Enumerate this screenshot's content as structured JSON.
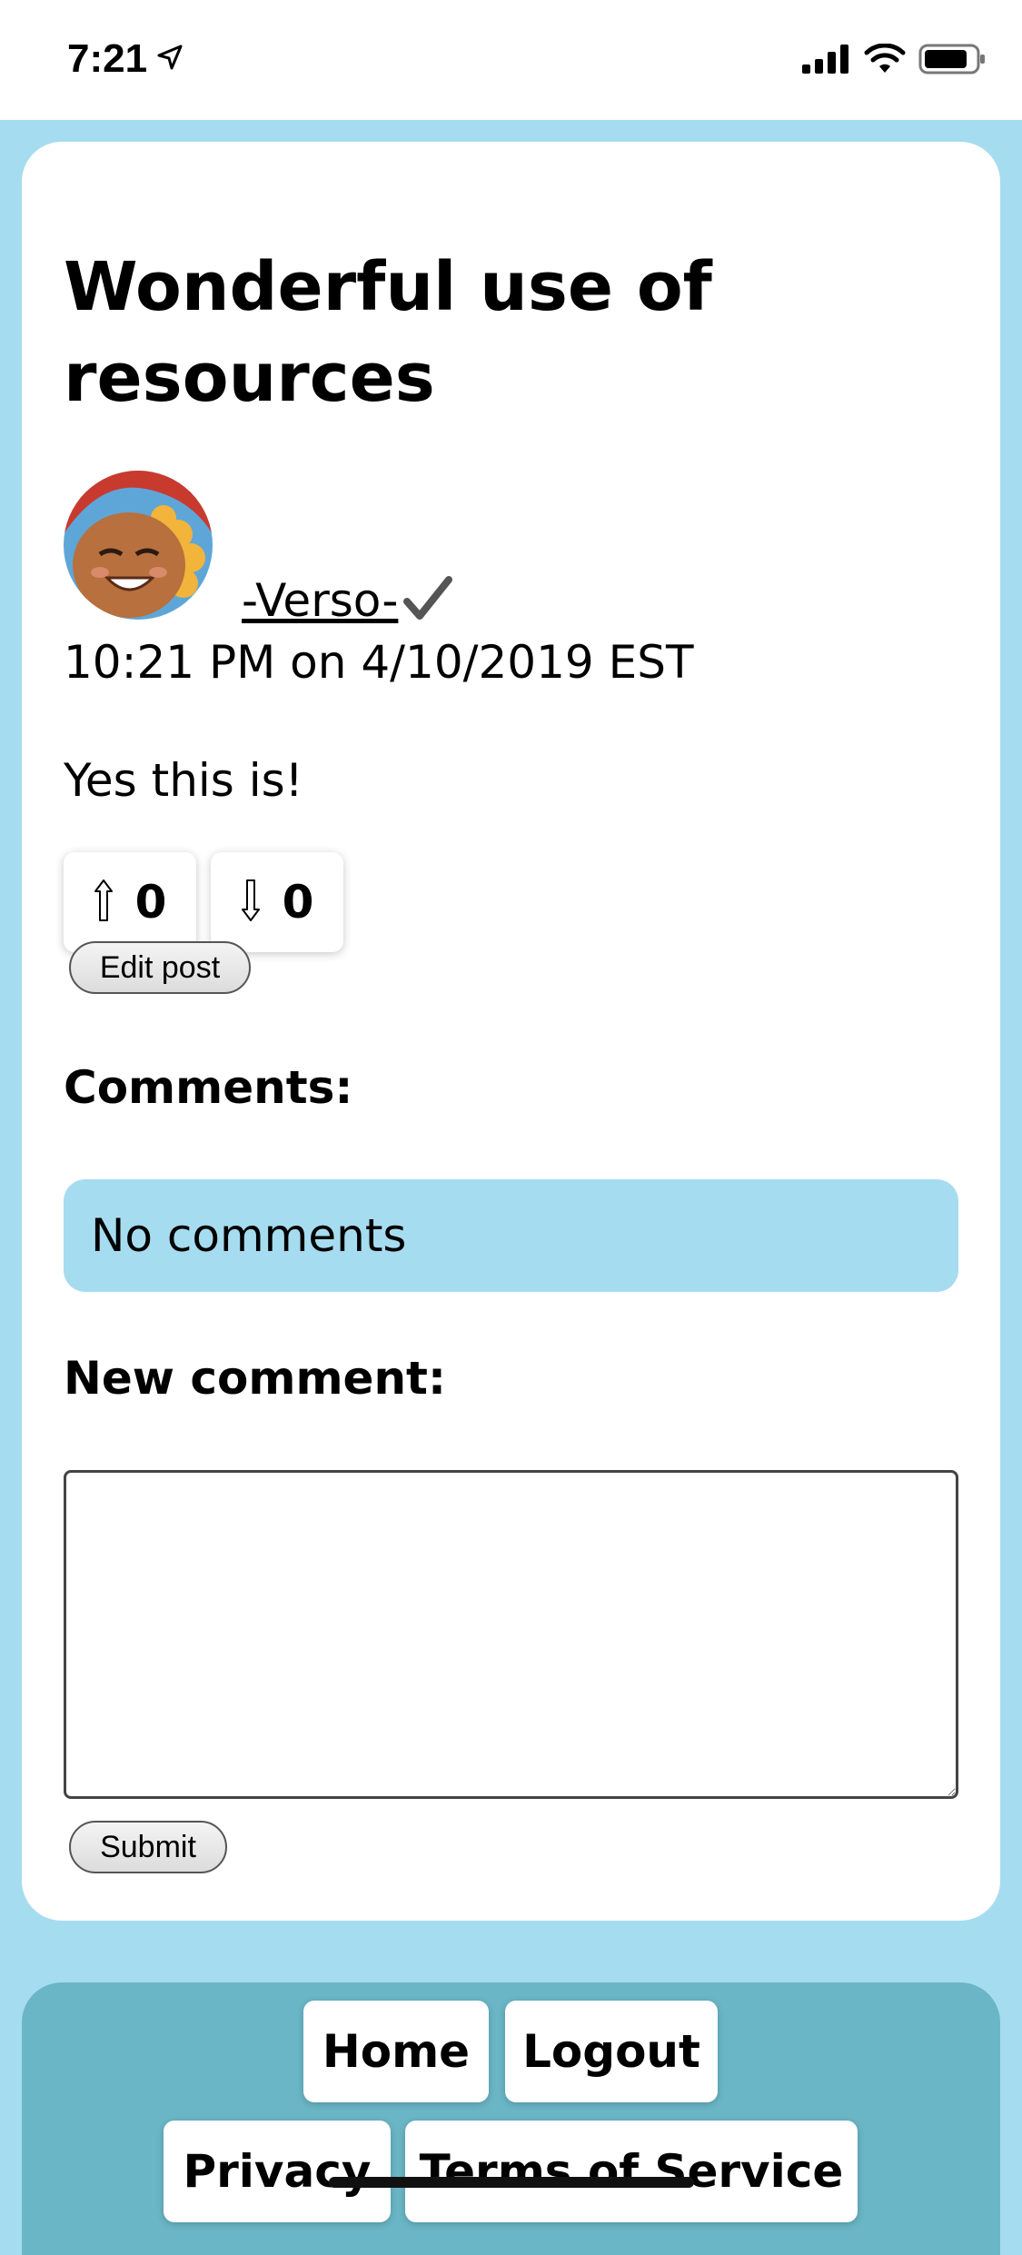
{
  "status_bar": {
    "time": "7:21"
  },
  "post": {
    "title": "Wonderful use of resources",
    "author": "-Verso-",
    "verified_mark": "✓",
    "timestamp": "10:21 PM on 4/10/2019 EST",
    "body": "Yes this is!",
    "upvotes": "0",
    "downvotes": "0",
    "up_arrow": "⇧",
    "down_arrow": "⇩",
    "edit_label": "Edit post"
  },
  "comments": {
    "heading": "Comments:",
    "empty_text": "No comments"
  },
  "new_comment": {
    "heading": "New comment:",
    "value": "",
    "submit_label": "Submit"
  },
  "footer": {
    "home": "Home",
    "logout": "Logout",
    "privacy": "Privacy",
    "terms": "Terms of Service"
  },
  "colors": {
    "page_background": "#a6dcef",
    "footer_background": "#6ab6c6",
    "card_background": "#ffffff"
  }
}
